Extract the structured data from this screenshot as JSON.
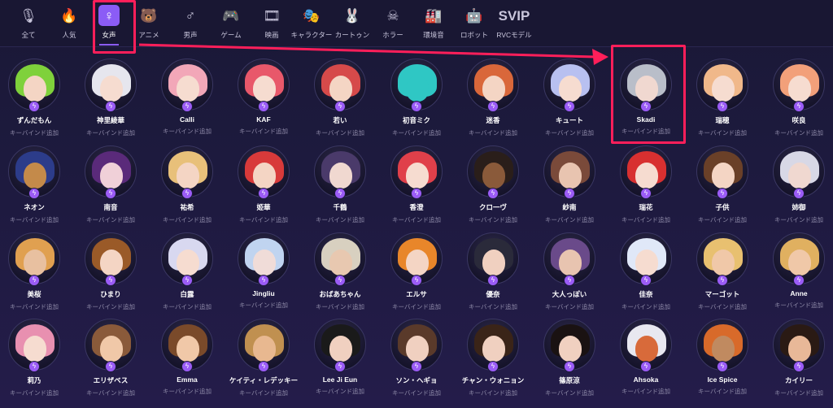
{
  "categories": [
    {
      "label": "全て",
      "icon": "microphone-icon",
      "glyph": "🎙"
    },
    {
      "label": "人気",
      "icon": "fire-icon",
      "glyph": "🔥"
    },
    {
      "label": "女声",
      "icon": "female-icon",
      "glyph": "♀"
    },
    {
      "label": "アニメ",
      "icon": "bear-icon",
      "glyph": "🐻"
    },
    {
      "label": "男声",
      "icon": "male-icon",
      "glyph": "♂"
    },
    {
      "label": "ゲーム",
      "icon": "gamepad-icon",
      "glyph": "🎮"
    },
    {
      "label": "映画",
      "icon": "film-reel-icon",
      "glyph": "🎞"
    },
    {
      "label": "キャラクター",
      "icon": "masks-icon",
      "glyph": "🎭"
    },
    {
      "label": "カートゥン",
      "icon": "rabbit-icon",
      "glyph": "🐰"
    },
    {
      "label": "ホラー",
      "icon": "skull-icon",
      "glyph": "☠"
    },
    {
      "label": "環境音",
      "icon": "factory-icon",
      "glyph": "🏭"
    },
    {
      "label": "ロボット",
      "icon": "robot-icon",
      "glyph": "🤖"
    },
    {
      "label": "RVCモデル",
      "icon": "svip-icon",
      "glyph": "SVIP"
    }
  ],
  "active_category": "女声",
  "badge_glyph": "ϟ",
  "voices": [
    {
      "name": "ずんだもん",
      "sub": "キーバインド追加",
      "hair": "#7fd13b",
      "skin": "#f4d5c4"
    },
    {
      "name": "神里綾華",
      "sub": "キーバインド追加",
      "hair": "#e6e6ee",
      "skin": "#f6dcd0"
    },
    {
      "name": "Calli",
      "sub": "キーバインド追加",
      "hair": "#f2a7b8",
      "skin": "#f6dcd0"
    },
    {
      "name": "KAF",
      "sub": "キーバインド追加",
      "hair": "#e8586a",
      "skin": "#f6dcd0"
    },
    {
      "name": "若い",
      "sub": "キーバインド追加",
      "hair": "#d64a4a",
      "skin": "#f4d5c4"
    },
    {
      "name": "初音ミク",
      "sub": "キーバインド追加",
      "hair": "#2fc7c4",
      "skin": "#2fc7c4"
    },
    {
      "name": "迷香",
      "sub": "キーバインド追加",
      "hair": "#d9673a",
      "skin": "#f4d5c4"
    },
    {
      "name": "キュート",
      "sub": "キーバインド追加",
      "hair": "#b8c0f0",
      "skin": "#f6dcd0"
    },
    {
      "name": "Skadi",
      "sub": "キーバインド追加",
      "hair": "#b9bec9",
      "skin": "#f0d8d0"
    },
    {
      "name": "瑞穂",
      "sub": "キーバインド追加",
      "hair": "#f0b88a",
      "skin": "#f6dcd0"
    },
    {
      "name": "咲良",
      "sub": "キーバインド追加",
      "hair": "#f2a07a",
      "skin": "#f6dcd0"
    },
    {
      "name": "ネオン",
      "sub": "キーバインド追加",
      "hair": "#2c3c8a",
      "skin": "#c48a4a"
    },
    {
      "name": "南音",
      "sub": "キーバインド追加",
      "hair": "#5a2a7a",
      "skin": "#f0d0d8"
    },
    {
      "name": "祐希",
      "sub": "キーバインド追加",
      "hair": "#e8c07a",
      "skin": "#f4d5c4"
    },
    {
      "name": "姫華",
      "sub": "キーバインド追加",
      "hair": "#d83a3a",
      "skin": "#f4d5c4"
    },
    {
      "name": "千鶴",
      "sub": "キーバインド追加",
      "hair": "#4a3a6a",
      "skin": "#f0d8d0"
    },
    {
      "name": "香澄",
      "sub": "キーバインド追加",
      "hair": "#e0404a",
      "skin": "#f6dcd0"
    },
    {
      "name": "クロ一ヴ",
      "sub": "キーバインド追加",
      "hair": "#2a1e1a",
      "skin": "#8a5a3a"
    },
    {
      "name": "紗南",
      "sub": "キーバインド追加",
      "hair": "#7a4a3a",
      "skin": "#e8c4b0"
    },
    {
      "name": "瑞花",
      "sub": "キーバインド追加",
      "hair": "#d83030",
      "skin": "#f6dcd0"
    },
    {
      "name": "子供",
      "sub": "キーバインド追加",
      "hair": "#6a4028",
      "skin": "#f4d5c4"
    },
    {
      "name": "姉御",
      "sub": "キーバインド追加",
      "hair": "#d8d8e6",
      "skin": "#f0d8d0"
    },
    {
      "name": "美桜",
      "sub": "キーバインド追加",
      "hair": "#e0a050",
      "skin": "#e8c0a0"
    },
    {
      "name": "ひまり",
      "sub": "キーバインド追加",
      "hair": "#9a5a28",
      "skin": "#f4d5c4"
    },
    {
      "name": "白露",
      "sub": "キーバインド追加",
      "hair": "#d8d8f0",
      "skin": "#f6dcd0"
    },
    {
      "name": "Jingliu",
      "sub": "キーバインド追加",
      "hair": "#c0d4f0",
      "skin": "#f0dcd8"
    },
    {
      "name": "おばあちゃん",
      "sub": "キーバインド追加",
      "hair": "#d8d0c0",
      "skin": "#e8c8b0"
    },
    {
      "name": "エルサ",
      "sub": "キーバインド追加",
      "hair": "#e8862a",
      "skin": "#f4d5c4"
    },
    {
      "name": "優奈",
      "sub": "キーバインド追加",
      "hair": "#2a2a3a",
      "skin": "#f0d0c0"
    },
    {
      "name": "大人っぽい",
      "sub": "キーバインド追加",
      "hair": "#6a4a8a",
      "skin": "#e8c4b0"
    },
    {
      "name": "佳奈",
      "sub": "キーバインド追加",
      "hair": "#e0e8f8",
      "skin": "#f6dcd0"
    },
    {
      "name": "マーゴット",
      "sub": "キーバインド追加",
      "hair": "#e8c070",
      "skin": "#f0c8a8"
    },
    {
      "name": "Anne",
      "sub": "キーバインド追加",
      "hair": "#e0b060",
      "skin": "#f0c8a8"
    },
    {
      "name": "莉乃",
      "sub": "キーバインド追加",
      "hair": "#e890b0",
      "skin": "#f6dcd0"
    },
    {
      "name": "エリザベス",
      "sub": "キーバインド追加",
      "hair": "#8a5a3a",
      "skin": "#f0c8a8"
    },
    {
      "name": "Emma",
      "sub": "キーバインド追加",
      "hair": "#7a4a2a",
      "skin": "#f0c8a8"
    },
    {
      "name": "ケイティ・レデッキー",
      "sub": "キーバインド追加",
      "hair": "#c09050",
      "skin": "#e8b890"
    },
    {
      "name": "Lee Ji Eun",
      "sub": "キーバインド追加",
      "hair": "#1a1a1a",
      "skin": "#f0d0c0"
    },
    {
      "name": "ソン・ヘギョ",
      "sub": "キーバインド追加",
      "hair": "#5a3a2a",
      "skin": "#f0d0c0"
    },
    {
      "name": "チャン・ウォニョン",
      "sub": "キーバインド追加",
      "hair": "#3a2418",
      "skin": "#f0d0c0"
    },
    {
      "name": "篠原涼",
      "sub": "キーバインド追加",
      "hair": "#1a1212",
      "skin": "#f0d0c0"
    },
    {
      "name": "Ahsoka",
      "sub": "キーバインド追加",
      "hair": "#e8e8f0",
      "skin": "#d86a3a"
    },
    {
      "name": "Ice Spice",
      "sub": "キーバインド追加",
      "hair": "#d86a2a",
      "skin": "#c08a60"
    },
    {
      "name": "カイリー",
      "sub": "キーバインド追加",
      "hair": "#2a1a14",
      "skin": "#e8b898"
    }
  ]
}
